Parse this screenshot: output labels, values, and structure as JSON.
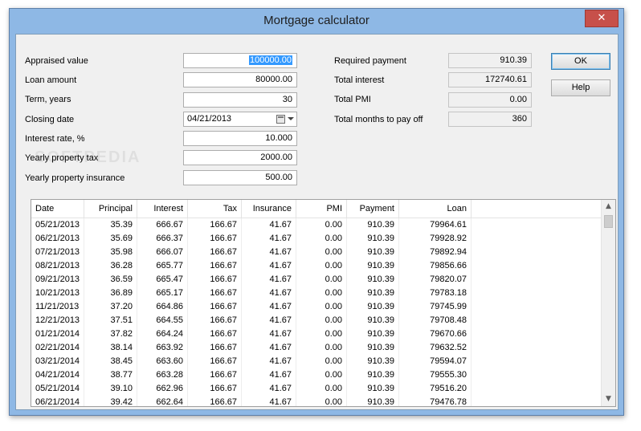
{
  "window": {
    "title": "Mortgage calculator",
    "close_glyph": "✕"
  },
  "inputs": [
    {
      "label": "Appraised value",
      "value": "100000.00"
    },
    {
      "label": "Loan amount",
      "value": "80000.00"
    },
    {
      "label": "Term, years",
      "value": "30"
    },
    {
      "label": "Closing date",
      "value": "04/21/2013"
    },
    {
      "label": "Interest rate, %",
      "value": "10.000"
    },
    {
      "label": "Yearly property tax",
      "value": "2000.00"
    },
    {
      "label": "Yearly property insurance",
      "value": "500.00"
    }
  ],
  "results": [
    {
      "label": "Required payment",
      "value": "910.39"
    },
    {
      "label": "Total interest",
      "value": "172740.61"
    },
    {
      "label": "Total PMI",
      "value": "0.00"
    },
    {
      "label": "Total months to pay off",
      "value": "360"
    }
  ],
  "buttons": {
    "ok": "OK",
    "help": "Help"
  },
  "watermark": "SOFTPEDIA",
  "table": {
    "columns": [
      "Date",
      "Principal",
      "Interest",
      "Tax",
      "Insurance",
      "PMI",
      "Payment",
      "Loan"
    ],
    "rows": [
      [
        "05/21/2013",
        "35.39",
        "666.67",
        "166.67",
        "41.67",
        "0.00",
        "910.39",
        "79964.61"
      ],
      [
        "06/21/2013",
        "35.69",
        "666.37",
        "166.67",
        "41.67",
        "0.00",
        "910.39",
        "79928.92"
      ],
      [
        "07/21/2013",
        "35.98",
        "666.07",
        "166.67",
        "41.67",
        "0.00",
        "910.39",
        "79892.94"
      ],
      [
        "08/21/2013",
        "36.28",
        "665.77",
        "166.67",
        "41.67",
        "0.00",
        "910.39",
        "79856.66"
      ],
      [
        "09/21/2013",
        "36.59",
        "665.47",
        "166.67",
        "41.67",
        "0.00",
        "910.39",
        "79820.07"
      ],
      [
        "10/21/2013",
        "36.89",
        "665.17",
        "166.67",
        "41.67",
        "0.00",
        "910.39",
        "79783.18"
      ],
      [
        "11/21/2013",
        "37.20",
        "664.86",
        "166.67",
        "41.67",
        "0.00",
        "910.39",
        "79745.99"
      ],
      [
        "12/21/2013",
        "37.51",
        "664.55",
        "166.67",
        "41.67",
        "0.00",
        "910.39",
        "79708.48"
      ],
      [
        "01/21/2014",
        "37.82",
        "664.24",
        "166.67",
        "41.67",
        "0.00",
        "910.39",
        "79670.66"
      ],
      [
        "02/21/2014",
        "38.14",
        "663.92",
        "166.67",
        "41.67",
        "0.00",
        "910.39",
        "79632.52"
      ],
      [
        "03/21/2014",
        "38.45",
        "663.60",
        "166.67",
        "41.67",
        "0.00",
        "910.39",
        "79594.07"
      ],
      [
        "04/21/2014",
        "38.77",
        "663.28",
        "166.67",
        "41.67",
        "0.00",
        "910.39",
        "79555.30"
      ],
      [
        "05/21/2014",
        "39.10",
        "662.96",
        "166.67",
        "41.67",
        "0.00",
        "910.39",
        "79516.20"
      ],
      [
        "06/21/2014",
        "39.42",
        "662.64",
        "166.67",
        "41.67",
        "0.00",
        "910.39",
        "79476.78"
      ]
    ]
  }
}
